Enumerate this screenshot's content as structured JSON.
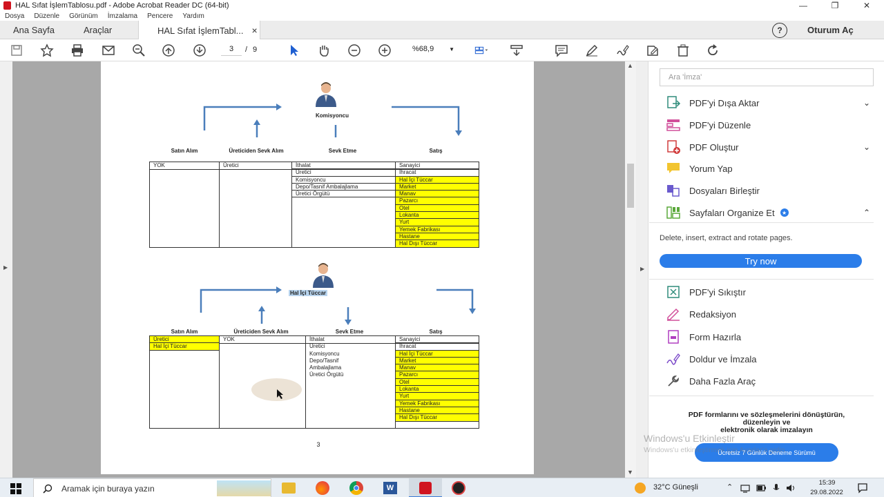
{
  "window": {
    "title": "HAL Sıfat İşlemTablosu.pdf - Adobe Acrobat Reader DC (64-bit)"
  },
  "menu": {
    "items": [
      "Dosya",
      "Düzenle",
      "Görünüm",
      "İmzalama",
      "Pencere",
      "Yardım"
    ]
  },
  "tabs": {
    "home": "Ana Sayfa",
    "tools": "Araçlar",
    "doc": "HAL Sıfat İşlemTabl...",
    "doc_close": "×",
    "help": "?",
    "signin": "Oturum Aç"
  },
  "toolbar": {
    "page_current": "3",
    "page_sep": "/",
    "page_total": "9",
    "zoom": "%68,9"
  },
  "doc": {
    "block1": {
      "person_label": "Komisyoncu",
      "headers": [
        "Satın Alım",
        "Üreticiden Sevk Alım",
        "Sevk Etme",
        "Satış"
      ],
      "col1": [
        "YOK"
      ],
      "col2": [
        "Üretici"
      ],
      "col3": [
        "İthalat",
        "Üretici",
        "Komisyoncu",
        "Depo/Tasnif Ambalajlama",
        "Üretici Örgütü"
      ],
      "col4": [
        "Sanayici",
        "İhracat",
        "Hal İçi Tüccar",
        "Market",
        "Manav",
        "Pazarcı",
        "Otel",
        "Lokanta",
        "Yurt",
        "Yemek Fabrikası",
        "Hastane",
        "Hal Dışı Tüccar"
      ]
    },
    "block2": {
      "person_label": "Hal İçi Tüccar",
      "headers": [
        "Satın Alım",
        "Üreticiden Sevk Alım",
        "Sevk Etme",
        "Satış"
      ],
      "col1": [
        "Üretici",
        "Hal İçi Tüccar"
      ],
      "col2": [
        "YOK"
      ],
      "col3": [
        "İthalat",
        "Üretici",
        "Komisyoncu",
        "Depo/Tasnif",
        "Ambalajlama",
        "Üretici Örgütü"
      ],
      "col4": [
        "Sanayici",
        "İhracat",
        "Hal İçi Tüccar",
        "Market",
        "Manav",
        "Pazarcı",
        "Otel",
        "Lokanta",
        "Yurt",
        "Yemek Fabrikası",
        "Hastane",
        "Hal Dışı Tüccar"
      ]
    },
    "page_number": "3"
  },
  "right_panel": {
    "search_placeholder": "Ara 'İmza'",
    "tools_top": [
      "PDF'yi Dışa Aktar",
      "PDF'yi Düzenle",
      "PDF Oluştur",
      "Yorum Yap",
      "Dosyaları Birleştir",
      "Sayfaları Organize Et"
    ],
    "organize_desc": "Delete, insert, extract and rotate pages.",
    "try_now": "Try now",
    "tools_bottom": [
      "PDF'yi Sıkıştır",
      "Redaksiyon",
      "Form Hazırla",
      "Doldur ve İmzala",
      "Daha Fazla Araç"
    ],
    "promo_line1": "PDF formlarını ve sözleşmelerini dönüştürün,",
    "promo_line2": "düzenleyin ve",
    "promo_line3": "elektronik olarak imzalayın",
    "trial_button": "Ücretsiz 7 Günlük Deneme Sürümü",
    "watermark1": "Windows'u Etkinleştir",
    "watermark2": "Windows'u etkinleştirmek için Ayarlar'a gidin."
  },
  "taskbar": {
    "search_placeholder": "Aramak için buraya yazın",
    "weather": "32°C  Güneşli",
    "time": "15:39",
    "date": "29.08.2022"
  }
}
